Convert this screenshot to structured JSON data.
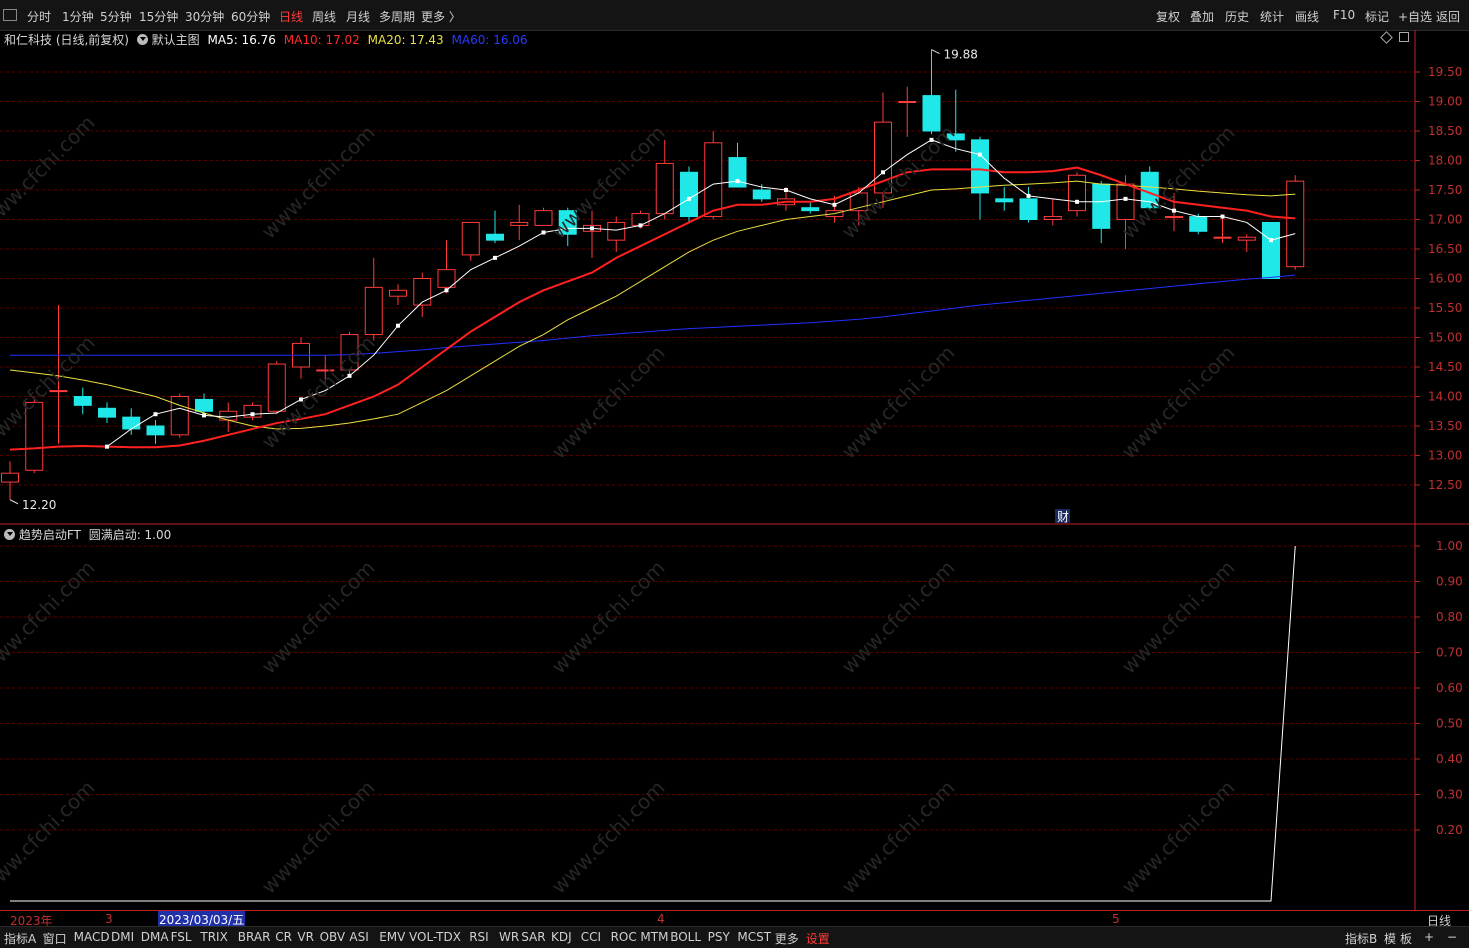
{
  "toolbar": {
    "periods": [
      "分时",
      "1分钟",
      "5分钟",
      "15分钟",
      "30分钟",
      "60分钟",
      "日线",
      "周线",
      "月线",
      "多周期",
      "更多 〉"
    ],
    "active_period": "日线",
    "right_items": [
      "复权",
      "叠加",
      "历史",
      "统计",
      "画线",
      "F10",
      "标记",
      "+自选",
      "返回"
    ]
  },
  "main_legend": {
    "stock": "和仁科技 (日线,前复权)",
    "template": "默认主图",
    "ma5": "MA5: 16.76",
    "ma10": "MA10: 17.02",
    "ma20": "MA20: 17.43",
    "ma60": "MA60: 16.06"
  },
  "sub_legend": {
    "indicator": "趋势启动FT",
    "value": "圆满启动: 1.00"
  },
  "markers": {
    "high": "19.88",
    "low": "12.20",
    "cai": "财"
  },
  "colors": {
    "up": "#ff3b3b",
    "down": "#20e8e8",
    "ma5": "#ffffff",
    "ma10": "#ff2020",
    "ma20": "#e8e040",
    "ma60": "#2030ff",
    "grid": "#5a0000"
  },
  "x_axis": {
    "year": "2023年",
    "m3": "3",
    "m4": "4",
    "m5": "5",
    "cursor_date": "2023/03/03/五",
    "period_label": "日线"
  },
  "bottom": {
    "left_items": [
      "指标A",
      "窗口",
      "MACD",
      "DMI",
      "DMA",
      "FSL",
      "TRIX",
      "BRAR",
      "CR",
      "VR",
      "OBV",
      "ASI",
      "EMV",
      "VOL-TDX",
      "RSI",
      "WR",
      "SAR",
      "KDJ",
      "CCI",
      "ROC",
      "MTM",
      "BOLL",
      "PSY",
      "MCST",
      "更多",
      "设置"
    ],
    "right_items": [
      "指标B",
      "模",
      "板",
      "+",
      "−"
    ]
  },
  "chart_data": [
    {
      "type": "candlestick",
      "title": "和仁科技 (日线,前复权)",
      "y_ticks": [
        19.5,
        19.0,
        18.5,
        18.0,
        17.5,
        17.0,
        16.5,
        16.0,
        15.5,
        15.0,
        14.5,
        14.0,
        13.5,
        13.0,
        12.5
      ],
      "ylim": [
        12.05,
        20.1
      ],
      "candles": [
        {
          "o": 12.55,
          "c": 12.7,
          "h": 12.9,
          "l": 12.25
        },
        {
          "o": 12.75,
          "c": 13.9,
          "h": 14.0,
          "l": 12.7
        },
        {
          "o": 14.1,
          "c": 14.1,
          "h": 15.55,
          "l": 13.2
        },
        {
          "o": 14.0,
          "c": 13.85,
          "h": 14.15,
          "l": 13.7
        },
        {
          "o": 13.8,
          "c": 13.65,
          "h": 13.9,
          "l": 13.55
        },
        {
          "o": 13.65,
          "c": 13.45,
          "h": 13.8,
          "l": 13.35
        },
        {
          "o": 13.5,
          "c": 13.35,
          "h": 13.6,
          "l": 13.2
        },
        {
          "o": 13.35,
          "c": 14.0,
          "h": 14.05,
          "l": 13.3
        },
        {
          "o": 13.95,
          "c": 13.75,
          "h": 14.05,
          "l": 13.7
        },
        {
          "o": 13.6,
          "c": 13.75,
          "h": 13.9,
          "l": 13.4
        },
        {
          "o": 13.65,
          "c": 13.85,
          "h": 13.9,
          "l": 13.6
        },
        {
          "o": 13.75,
          "c": 14.55,
          "h": 14.6,
          "l": 13.7
        },
        {
          "o": 14.5,
          "c": 14.9,
          "h": 15.0,
          "l": 14.3
        },
        {
          "o": 14.45,
          "c": 14.45,
          "h": 14.7,
          "l": 14.2
        },
        {
          "o": 14.45,
          "c": 15.05,
          "h": 15.1,
          "l": 14.35
        },
        {
          "o": 15.05,
          "c": 15.85,
          "h": 16.35,
          "l": 14.95
        },
        {
          "o": 15.7,
          "c": 15.8,
          "h": 15.9,
          "l": 15.55
        },
        {
          "o": 15.55,
          "c": 16.0,
          "h": 16.1,
          "l": 15.35
        },
        {
          "o": 15.85,
          "c": 16.15,
          "h": 16.65,
          "l": 15.75
        },
        {
          "o": 16.4,
          "c": 16.95,
          "h": 16.95,
          "l": 16.3
        },
        {
          "o": 16.75,
          "c": 16.65,
          "h": 17.15,
          "l": 16.6
        },
        {
          "o": 16.9,
          "c": 16.95,
          "h": 17.25,
          "l": 16.65
        },
        {
          "o": 16.9,
          "c": 17.15,
          "h": 17.2,
          "l": 16.9
        },
        {
          "o": 17.15,
          "c": 16.75,
          "h": 17.2,
          "l": 16.55
        },
        {
          "o": 16.8,
          "c": 16.9,
          "h": 17.15,
          "l": 16.35
        },
        {
          "o": 16.65,
          "c": 16.95,
          "h": 17.05,
          "l": 16.45
        },
        {
          "o": 16.9,
          "c": 17.1,
          "h": 17.15,
          "l": 16.85
        },
        {
          "o": 17.1,
          "c": 17.95,
          "h": 18.35,
          "l": 17.0
        },
        {
          "o": 17.8,
          "c": 17.05,
          "h": 17.9,
          "l": 16.95
        },
        {
          "o": 17.05,
          "c": 18.3,
          "h": 18.5,
          "l": 17.0
        },
        {
          "o": 18.05,
          "c": 17.55,
          "h": 18.3,
          "l": 17.55
        },
        {
          "o": 17.5,
          "c": 17.35,
          "h": 17.6,
          "l": 17.3
        },
        {
          "o": 17.25,
          "c": 17.35,
          "h": 17.55,
          "l": 17.15
        },
        {
          "o": 17.2,
          "c": 17.15,
          "h": 17.3,
          "l": 17.1
        },
        {
          "o": 17.05,
          "c": 17.15,
          "h": 17.4,
          "l": 16.95
        },
        {
          "o": 17.15,
          "c": 17.45,
          "h": 17.55,
          "l": 16.9
        },
        {
          "o": 17.45,
          "c": 18.65,
          "h": 19.15,
          "l": 17.2
        },
        {
          "o": 19.0,
          "c": 19.0,
          "h": 19.25,
          "l": 18.4
        },
        {
          "o": 19.1,
          "c": 18.5,
          "h": 19.88,
          "l": 18.45
        },
        {
          "o": 18.45,
          "c": 18.35,
          "h": 19.2,
          "l": 18.15
        },
        {
          "o": 18.35,
          "c": 17.45,
          "h": 18.4,
          "l": 17.0
        },
        {
          "o": 17.35,
          "c": 17.3,
          "h": 17.55,
          "l": 17.15
        },
        {
          "o": 17.35,
          "c": 17.0,
          "h": 17.55,
          "l": 16.95
        },
        {
          "o": 17.0,
          "c": 17.05,
          "h": 17.35,
          "l": 16.9
        },
        {
          "o": 17.15,
          "c": 17.75,
          "h": 17.8,
          "l": 17.05
        },
        {
          "o": 17.6,
          "c": 16.85,
          "h": 17.65,
          "l": 16.6
        },
        {
          "o": 17.0,
          "c": 17.6,
          "h": 17.75,
          "l": 16.5
        },
        {
          "o": 17.8,
          "c": 17.2,
          "h": 17.9,
          "l": 17.15
        },
        {
          "o": 17.05,
          "c": 17.05,
          "h": 17.45,
          "l": 16.8
        },
        {
          "o": 17.05,
          "c": 16.8,
          "h": 17.1,
          "l": 16.75
        },
        {
          "o": 16.7,
          "c": 16.7,
          "h": 17.05,
          "l": 16.6
        },
        {
          "o": 16.65,
          "c": 16.7,
          "h": 16.75,
          "l": 16.45
        },
        {
          "o": 16.95,
          "c": 16.0,
          "h": 16.95,
          "l": 16.0
        },
        {
          "o": 16.2,
          "c": 17.65,
          "h": 17.75,
          "l": 16.15
        }
      ],
      "ma5": [
        null,
        null,
        null,
        null,
        13.15,
        13.45,
        13.7,
        13.8,
        13.68,
        13.65,
        13.7,
        13.72,
        13.95,
        14.1,
        14.35,
        14.7,
        15.2,
        15.6,
        15.8,
        16.15,
        16.35,
        16.55,
        16.78,
        16.85,
        16.85,
        16.82,
        16.9,
        17.1,
        17.35,
        17.6,
        17.65,
        17.55,
        17.5,
        17.35,
        17.25,
        17.45,
        17.8,
        18.1,
        18.35,
        18.2,
        18.1,
        17.7,
        17.4,
        17.35,
        17.3,
        17.3,
        17.35,
        17.3,
        17.15,
        17.05,
        17.05,
        16.95,
        16.65,
        16.76
      ],
      "ma10": [
        13.1,
        13.12,
        13.15,
        13.16,
        13.15,
        13.14,
        13.14,
        13.17,
        13.25,
        13.35,
        13.45,
        13.55,
        13.62,
        13.7,
        13.85,
        14.0,
        14.2,
        14.5,
        14.8,
        15.1,
        15.35,
        15.6,
        15.8,
        15.95,
        16.1,
        16.35,
        16.55,
        16.75,
        16.95,
        17.15,
        17.25,
        17.25,
        17.3,
        17.3,
        17.35,
        17.5,
        17.65,
        17.8,
        17.85,
        17.85,
        17.85,
        17.8,
        17.8,
        17.82,
        17.88,
        17.75,
        17.6,
        17.45,
        17.3,
        17.25,
        17.2,
        17.15,
        17.05,
        17.02
      ],
      "ma20": [
        14.45,
        14.4,
        14.35,
        14.28,
        14.2,
        14.1,
        14.0,
        13.85,
        13.72,
        13.6,
        13.5,
        13.45,
        13.46,
        13.5,
        13.55,
        13.62,
        13.7,
        13.9,
        14.1,
        14.35,
        14.6,
        14.85,
        15.05,
        15.3,
        15.5,
        15.7,
        15.95,
        16.2,
        16.45,
        16.65,
        16.8,
        16.9,
        17.0,
        17.05,
        17.1,
        17.2,
        17.3,
        17.4,
        17.5,
        17.52,
        17.55,
        17.58,
        17.6,
        17.62,
        17.65,
        17.6,
        17.58,
        17.55,
        17.52,
        17.48,
        17.45,
        17.42,
        17.4,
        17.43
      ],
      "ma60": [
        14.7,
        14.7,
        14.7,
        14.7,
        14.7,
        14.7,
        14.7,
        14.7,
        14.7,
        14.7,
        14.7,
        14.7,
        14.7,
        14.7,
        14.71,
        14.73,
        14.76,
        14.79,
        14.83,
        14.86,
        14.89,
        14.92,
        14.95,
        14.99,
        15.03,
        15.06,
        15.09,
        15.12,
        15.15,
        15.17,
        15.19,
        15.21,
        15.23,
        15.25,
        15.28,
        15.31,
        15.35,
        15.4,
        15.45,
        15.5,
        15.55,
        15.59,
        15.63,
        15.67,
        15.71,
        15.75,
        15.79,
        15.83,
        15.87,
        15.91,
        15.95,
        15.99,
        16.02,
        16.06
      ]
    },
    {
      "type": "line",
      "title": "趋势启动FT",
      "series": [
        {
          "name": "圆满启动",
          "values": [
            0,
            0,
            0,
            0,
            0,
            0,
            0,
            0,
            0,
            0,
            0,
            0,
            0,
            0,
            0,
            0,
            0,
            0,
            0,
            0,
            0,
            0,
            0,
            0,
            0,
            0,
            0,
            0,
            0,
            0,
            0,
            0,
            0,
            0,
            0,
            0,
            0,
            0,
            0,
            0,
            0,
            0,
            0,
            0,
            0,
            0,
            0,
            0,
            0,
            0,
            0,
            0,
            0,
            1.0
          ]
        }
      ],
      "y_ticks": [
        1.0,
        0.9,
        0.8,
        0.7,
        0.6,
        0.5,
        0.4,
        0.3,
        0.2
      ],
      "ylim": [
        0,
        1.0
      ]
    }
  ]
}
